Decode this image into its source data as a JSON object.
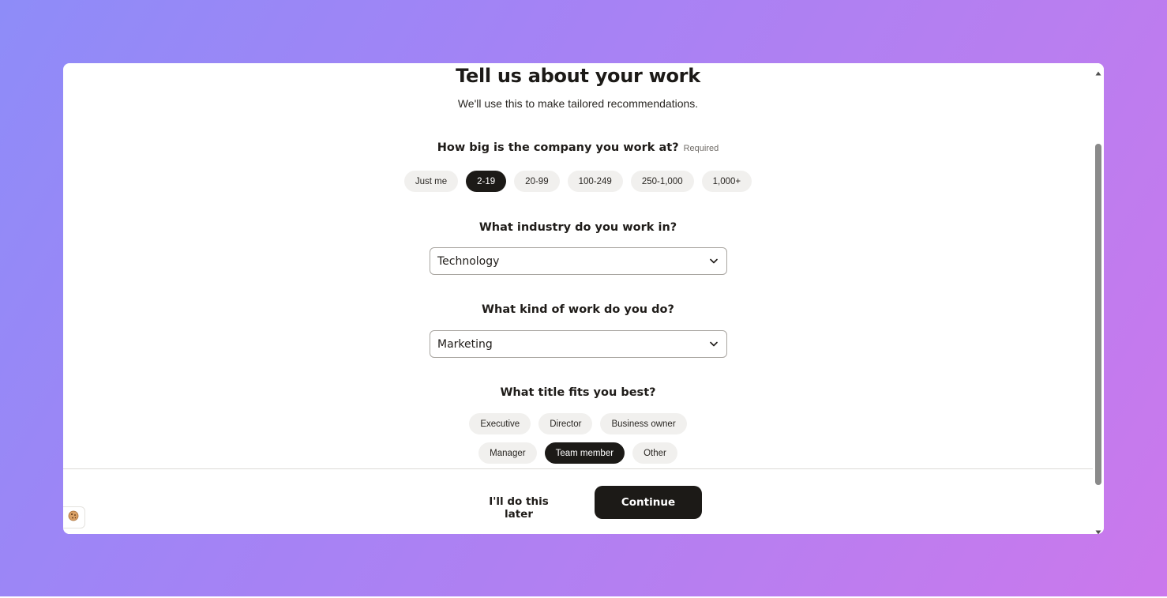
{
  "modal": {
    "title": "Tell us about your work",
    "subtitle": "We'll use this to make tailored recommendations."
  },
  "company_size": {
    "question": "How big is the company you work at?",
    "required_label": "Required",
    "options": [
      "Just me",
      "2-19",
      "20-99",
      "100-249",
      "250-1,000",
      "1,000+"
    ],
    "selected": "2-19"
  },
  "industry": {
    "question": "What industry do you work in?",
    "value": "Technology"
  },
  "work_kind": {
    "question": "What kind of work do you do?",
    "value": "Marketing"
  },
  "title_fit": {
    "question": "What title fits you best?",
    "row1": [
      "Executive",
      "Director",
      "Business owner"
    ],
    "row2": [
      "Manager",
      "Team member",
      "Other"
    ],
    "selected": "Team member"
  },
  "footer": {
    "later_label": "I'll do this later",
    "continue_label": "Continue"
  },
  "icons": {
    "cookie": "cookie-icon",
    "chevron": "chevron-down-icon",
    "scroll_up": "scroll-up-arrow",
    "scroll_down": "scroll-down-arrow"
  },
  "colors": {
    "background_gradient_start": "#8e8cf8",
    "background_gradient_end": "#cb78ec",
    "selected_chip": "#1c1a17",
    "chip": "#f1f0ee",
    "primary_button": "#1c1a17"
  }
}
